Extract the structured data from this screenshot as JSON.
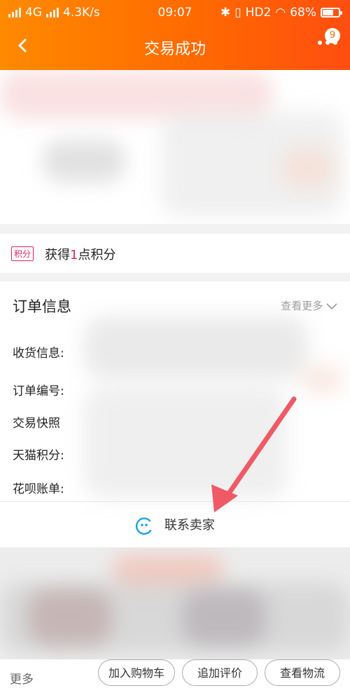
{
  "status_bar": {
    "network": "4G",
    "speed": "4.3K/s",
    "time": "09:07",
    "hd": "HD2",
    "battery_percent": "68%",
    "battery_level": 0.68
  },
  "header": {
    "title": "交易成功",
    "back_icon": "chevron-left-icon",
    "more_icon": "more-dots-icon",
    "notification_count": "9"
  },
  "points": {
    "tag": "积分",
    "prefix": "获得",
    "number": "1",
    "suffix": "点积分"
  },
  "order_info": {
    "title": "订单信息",
    "view_more": "查看更多",
    "rows": [
      "收货信息:",
      "订单编号:",
      "交易快照",
      "天猫积分:",
      "花呗账单:"
    ],
    "contact_seller": "联系卖家"
  },
  "bottom_bar": {
    "more": "更多",
    "buttons": [
      "加入购物车",
      "追加评价",
      "查看物流"
    ]
  },
  "colors": {
    "header_start": "#ff8a00",
    "header_end": "#ff4e10",
    "accent": "#e0245e",
    "arrow": "#f05a66",
    "contact_icon": "#1aa3e8"
  }
}
